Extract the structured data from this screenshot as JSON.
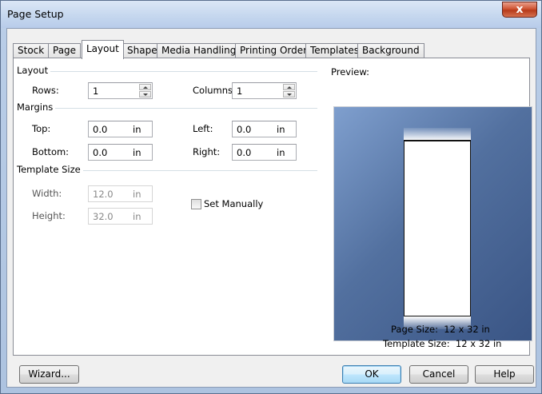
{
  "window": {
    "title": "Page Setup",
    "close_label": "x"
  },
  "tabs": [
    "Stock",
    "Page",
    "Layout",
    "Shape",
    "Media Handling",
    "Printing Order",
    "Templates",
    "Background"
  ],
  "active_tab": "Layout",
  "layout_group": {
    "title": "Layout",
    "rows_label": "Rows:",
    "rows_value": "1",
    "columns_label": "Columns:",
    "columns_value": "1"
  },
  "margins_group": {
    "title": "Margins",
    "top_label": "Top:",
    "top_value": "0.0",
    "top_unit": "in",
    "left_label": "Left:",
    "left_value": "0.0",
    "left_unit": "in",
    "bottom_label": "Bottom:",
    "bottom_value": "0.0",
    "bottom_unit": "in",
    "right_label": "Right:",
    "right_value": "0.0",
    "right_unit": "in"
  },
  "template_group": {
    "title": "Template Size",
    "width_label": "Width:",
    "width_value": "12.0",
    "width_unit": "in",
    "height_label": "Height:",
    "height_value": "32.0",
    "height_unit": "in",
    "set_manually_label": "Set Manually",
    "set_manually_checked": false
  },
  "preview": {
    "label": "Preview:",
    "page_size": "Page Size:  12 x 32 in",
    "template_size": "Template Size:  12 x 32 in"
  },
  "buttons": {
    "wizard": "Wizard...",
    "ok": "OK",
    "cancel": "Cancel",
    "help": "Help"
  },
  "colors": {
    "preview_bg": "#52709f",
    "title_bar": "#c4d6ee",
    "close_button": "#cf5533"
  }
}
